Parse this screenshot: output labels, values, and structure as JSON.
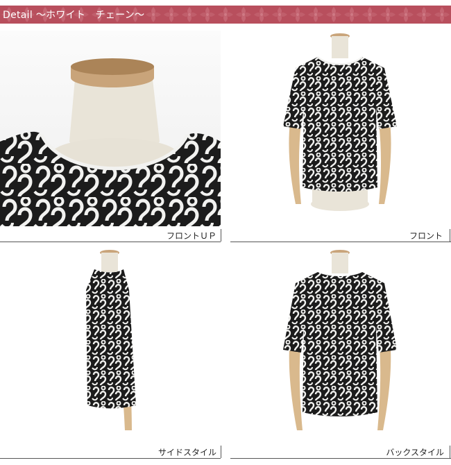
{
  "header": {
    "title": "Detail ～ホワイト　チェーン～",
    "background_color": "#b84f5d"
  },
  "photos": [
    {
      "caption": "フロントＵＰ",
      "image": "closeup-neckline-photo"
    },
    {
      "caption": "フロント",
      "image": "front-view-photo"
    },
    {
      "caption": "サイドスタイル",
      "image": "side-view-photo"
    },
    {
      "caption": "バックスタイル",
      "image": "back-view-photo"
    }
  ],
  "colors": {
    "fabric_dark": "#1c1c1c",
    "fabric_light": "#f2f2f0",
    "mannequin": "#e9e4d8",
    "wood": "#c9a47a"
  }
}
